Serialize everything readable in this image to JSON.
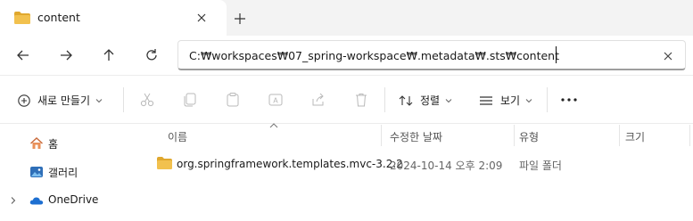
{
  "tab": {
    "title": "content"
  },
  "address": {
    "path": "C:₩workspaces₩07_spring-workspace₩.metadata₩.sts₩content"
  },
  "toolbar": {
    "new_label": "새로 만들기",
    "sort_label": "정렬",
    "view_label": "보기"
  },
  "nav": {
    "items": [
      {
        "label": "홈"
      },
      {
        "label": "갤러리"
      },
      {
        "label": "OneDrive"
      }
    ]
  },
  "columns": {
    "name": "이름",
    "date": "수정한 날짜",
    "type": "유형",
    "size": "크기"
  },
  "files": [
    {
      "name": "org.springframework.templates.mvc-3.2.2",
      "date": "2024-10-14 오후 2:09",
      "type": "파일 폴더"
    }
  ],
  "colors": {
    "folder": "#f2c14e",
    "folder_dark": "#e0a82e",
    "accent": "#0067c0"
  }
}
